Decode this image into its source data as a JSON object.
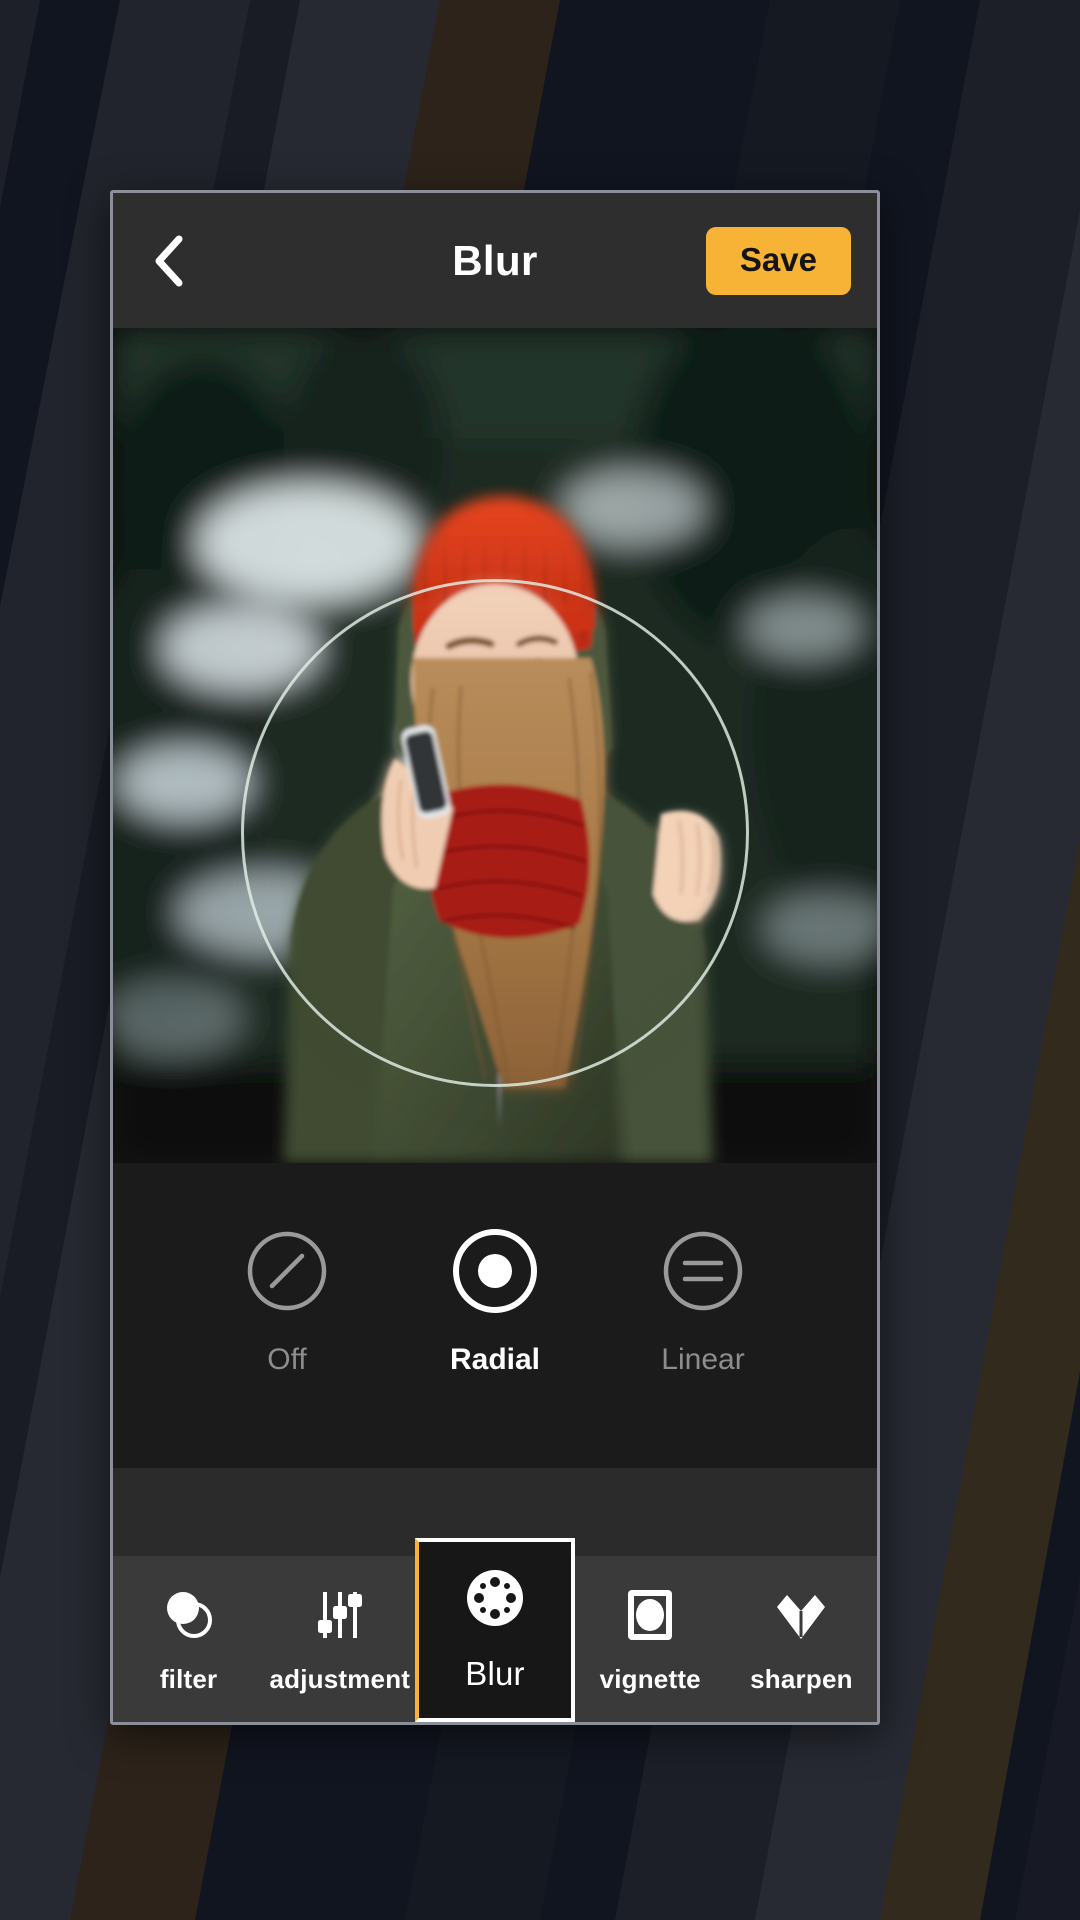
{
  "app": {
    "background_color": "#111520",
    "accent_color": "#f6b335",
    "panel_color": "#2e2e2e"
  },
  "header": {
    "back_icon": "chevron-left-icon",
    "title": "Blur",
    "save_label": "Save"
  },
  "canvas": {
    "photo_description": "Woman in red knit beanie and red scarf wearing an olive green puffer jacket, talking on a phone, blurred snowy evergreen forest background",
    "overlay": "radial-blur-guide-circle"
  },
  "modes": {
    "selected": "Radial",
    "items": [
      {
        "label": "Off",
        "icon": "circle-slash-icon",
        "selected": false
      },
      {
        "label": "Radial",
        "icon": "circle-dot-icon",
        "selected": true
      },
      {
        "label": "Linear",
        "icon": "circle-lines-icon",
        "selected": false
      }
    ]
  },
  "toolbar": {
    "active": "Blur",
    "items": [
      {
        "label": "filter",
        "icon": "overlapping-circles-icon",
        "active": false
      },
      {
        "label": "adjustment",
        "icon": "sliders-icon",
        "active": false
      },
      {
        "label": "Blur",
        "icon": "aperture-dots-icon",
        "active": true
      },
      {
        "label": "vignette",
        "icon": "framed-circle-icon",
        "active": false
      },
      {
        "label": "sharpen",
        "icon": "diamond-icon",
        "active": false
      }
    ]
  }
}
